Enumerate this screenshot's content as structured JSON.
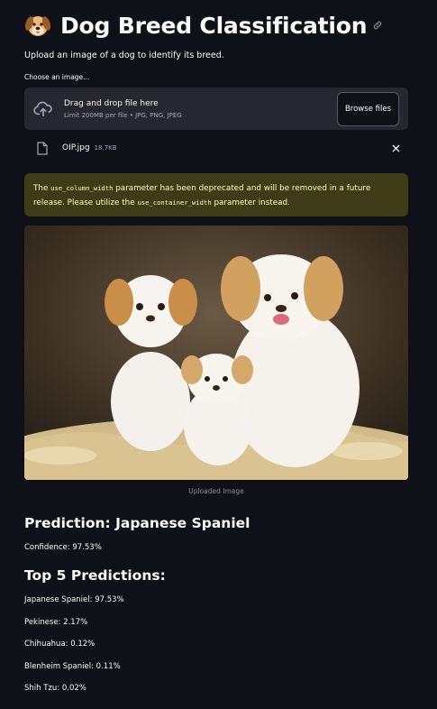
{
  "header": {
    "title": "Dog Breed Classification",
    "title_emoji_icon": "dog-face-icon",
    "anchor_icon": "link-icon"
  },
  "subtitle": "Upload an image of a dog to identify its breed.",
  "uploader": {
    "label": "Choose an image...",
    "drop_text": "Drag and drop file here",
    "limit_text": "Limit 200MB per file • JPG, PNG, JPEG",
    "browse_label": "Browse files",
    "file": {
      "name": "OIP.jpg",
      "size": "18.7KB"
    }
  },
  "warning": {
    "pre": "The ",
    "code1": "use_column_width",
    "mid": " parameter has been deprecated and will be removed in a future release. Please utilize the ",
    "code2": "use_container_width",
    "post": " parameter instead."
  },
  "image": {
    "caption": "Uploaded Image"
  },
  "prediction": {
    "heading": "Prediction: Japanese Spaniel",
    "confidence": "Confidence: 97.53%"
  },
  "top5": {
    "heading": "Top 5 Predictions:",
    "items": [
      "Japanese Spaniel: 97.53%",
      "Pekinese: 2.17%",
      "Chihuahua: 0.12%",
      "Blenheim Spaniel: 0.11%",
      "Shih Tzu: 0.02%"
    ]
  },
  "colors": {
    "background": "#0e1117",
    "surface": "#262730",
    "warning_bg": "#3e3b16",
    "warning_text": "#ffffc2"
  }
}
